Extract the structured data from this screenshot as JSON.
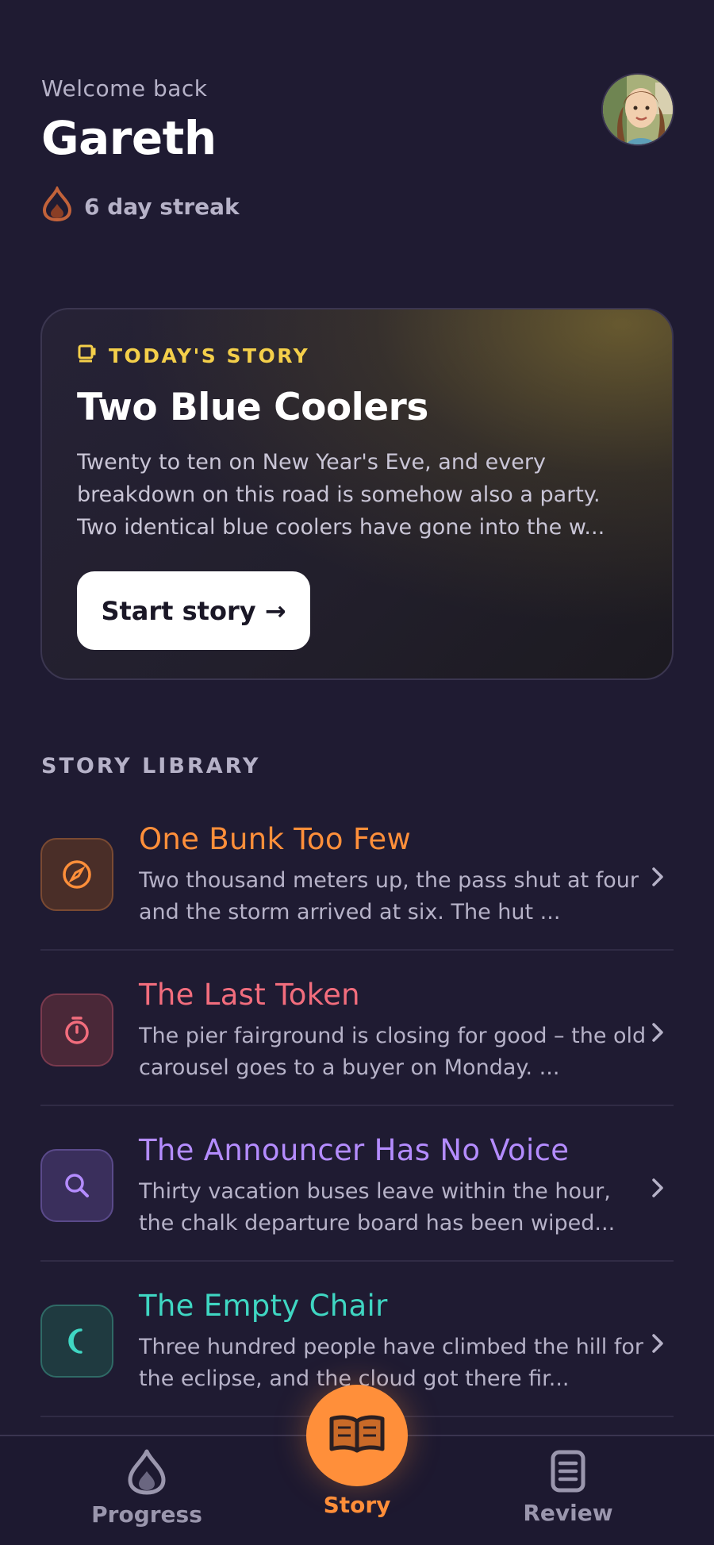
{
  "header": {
    "welcome": "Welcome back",
    "username": "Gareth",
    "streak": "6 day streak"
  },
  "featured": {
    "kicker": "TODAY'S STORY",
    "title": "Two Blue Coolers",
    "description": "Twenty to ten on New Year's Eve, and every breakdown on this road is somehow also a party. Two identical blue coolers have gone into the w...",
    "button": "Start story →"
  },
  "library": {
    "heading": "STORY LIBRARY",
    "items": [
      {
        "title": "One Bunk Too Few",
        "description": "Two thousand meters up, the pass shut at four and the storm arrived at six. The hut ...",
        "color": "#ff8f3a",
        "icon": "compass-icon"
      },
      {
        "title": "The Last Token",
        "description": "The pier fairground is closing for good – the old carousel goes to a buyer on Monday. ...",
        "color": "#f26d7d",
        "icon": "stopwatch-icon"
      },
      {
        "title": "The Announcer Has No Voice",
        "description": "Thirty vacation buses leave within the hour, the chalk departure board has been wiped...",
        "color": "#b48cff",
        "icon": "search-icon"
      },
      {
        "title": "The Empty Chair",
        "description": "Three hundred people have climbed the hill for the eclipse, and the cloud got there fir...",
        "color": "#3fd6c2",
        "icon": "moon-icon"
      }
    ]
  },
  "nav": {
    "progress": "Progress",
    "story": "Story",
    "review": "Review"
  },
  "colors": {
    "accent": "#ff8f3a",
    "gold": "#f4cf4a",
    "background": "#1f1b32"
  }
}
